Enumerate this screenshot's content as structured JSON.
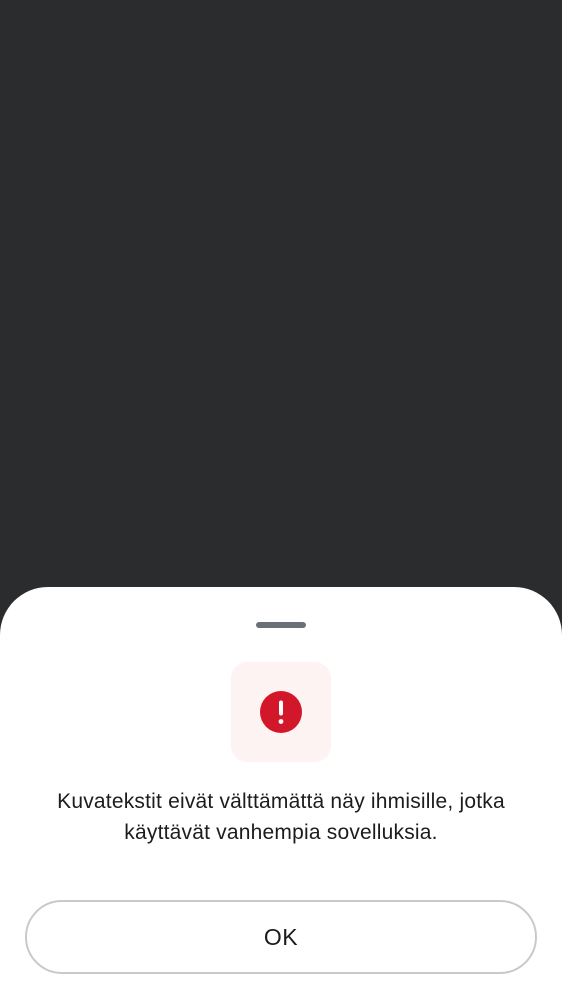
{
  "colors": {
    "backdrop": "#2b2c2e",
    "sheet_background": "#ffffff",
    "drag_handle": "#6b7077",
    "icon_tile_background": "#fdf3f2",
    "alert_red": "#d3172b",
    "text": "#1b1c1e",
    "button_border": "#c8c9cc"
  },
  "sheet": {
    "icon": "alert-circle-icon",
    "message": "Kuvatekstit eivät välttämättä näy ihmisille, jotka käyttävät vanhempia sovelluksia.",
    "ok_label": "OK"
  }
}
